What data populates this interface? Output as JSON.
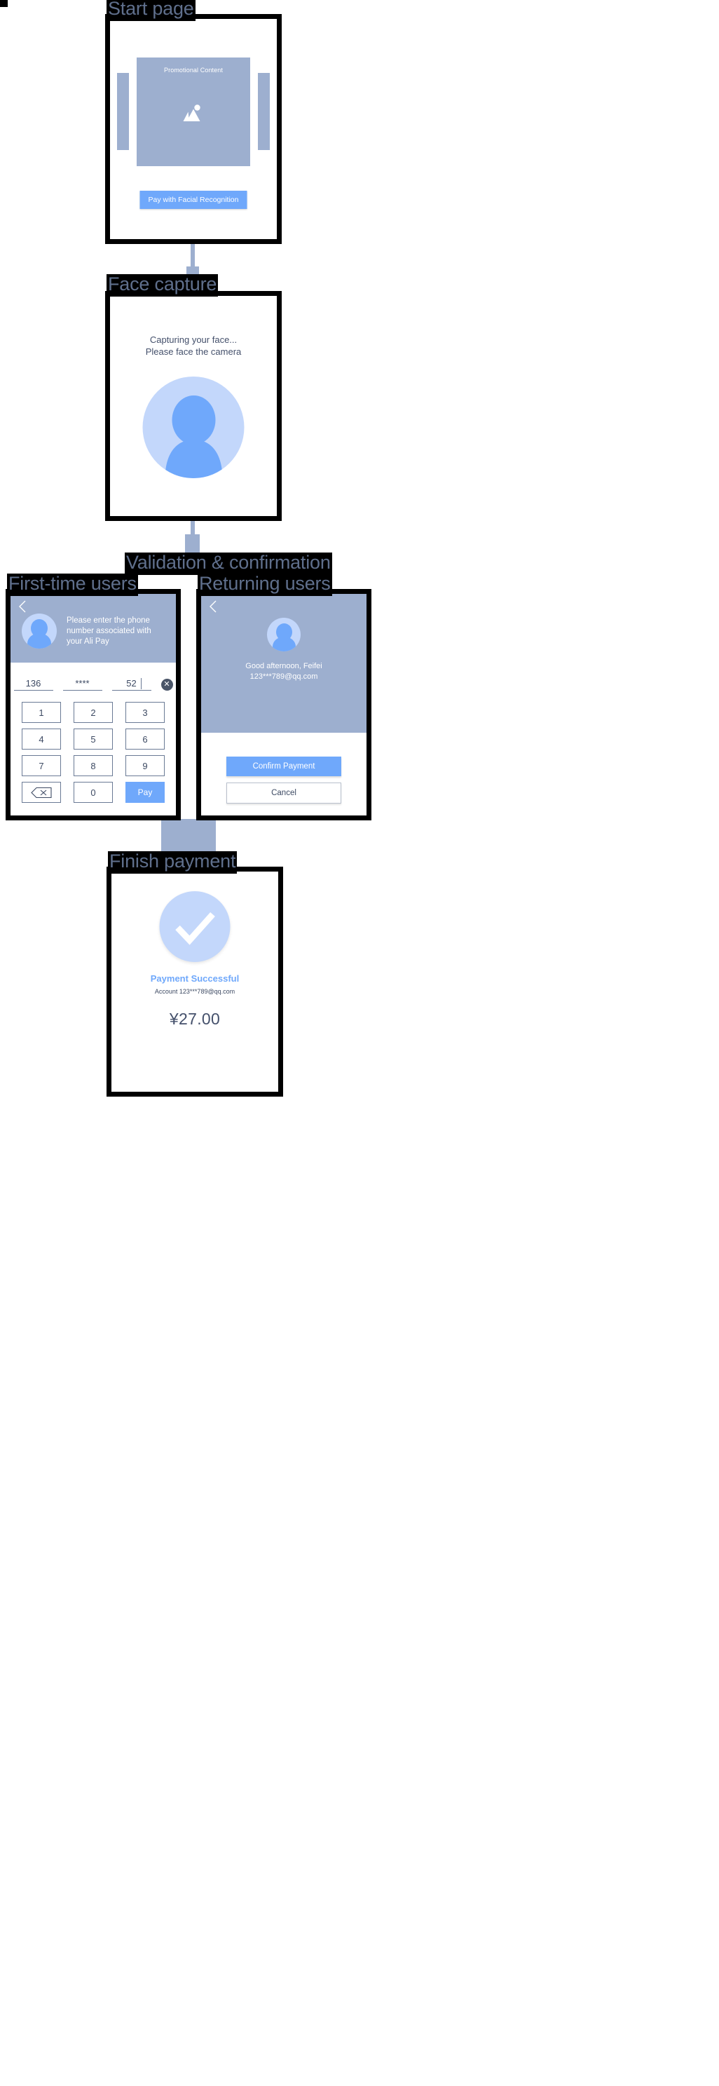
{
  "diagram": {
    "title_stages": [
      "Start page",
      "Face capture",
      "Validation & confirmation",
      "First-time users",
      "Returning users",
      "Finish payment"
    ],
    "colors": {
      "accent_blue": "#6fa8fb",
      "muted_blue": "#9dafcf",
      "light_blue": "#c3d7fb",
      "frame_black": "#000000",
      "label_text": "#5f6f8c",
      "body_text": "#3d4a63"
    }
  },
  "stage_labels": {
    "start": "Start page",
    "face_capture": "Face capture",
    "validation": "Validation & confirmation",
    "first_time": "First-time users",
    "returning": "Returning users",
    "finish": "Finish payment"
  },
  "start_page": {
    "promo_title": "Promotional Content",
    "cta_label": "Pay with Facial Recognition",
    "image_icon": "image-placeholder-icon"
  },
  "face_capture": {
    "line1": "Capturing your face...",
    "line2": "Please face the camera",
    "avatar_icon": "person-avatar-icon"
  },
  "first_time_users": {
    "back_icon": "back-chevron-icon",
    "avatar_icon": "person-avatar-icon",
    "message": "Please enter the phone number associated with your Ali Pay",
    "phone_segments": [
      "136",
      "****",
      "52"
    ],
    "clear_icon": "clear-circle-x-icon",
    "keypad": [
      "1",
      "2",
      "3",
      "4",
      "5",
      "6",
      "7",
      "8",
      "9"
    ],
    "backspace_icon": "backspace-delete-icon",
    "zero_key": "0",
    "pay_label": "Pay"
  },
  "returning_users": {
    "back_icon": "back-chevron-icon",
    "avatar_icon": "person-avatar-icon",
    "greeting": "Good afternoon, Feifei",
    "account": "123***789@qq.com",
    "confirm_label": "Confirm Payment",
    "cancel_label": "Cancel"
  },
  "finish_payment": {
    "check_icon": "success-check-icon",
    "title": "Payment Successful",
    "account_line": "Account 123***789@qq.com",
    "amount": "¥27.00"
  }
}
